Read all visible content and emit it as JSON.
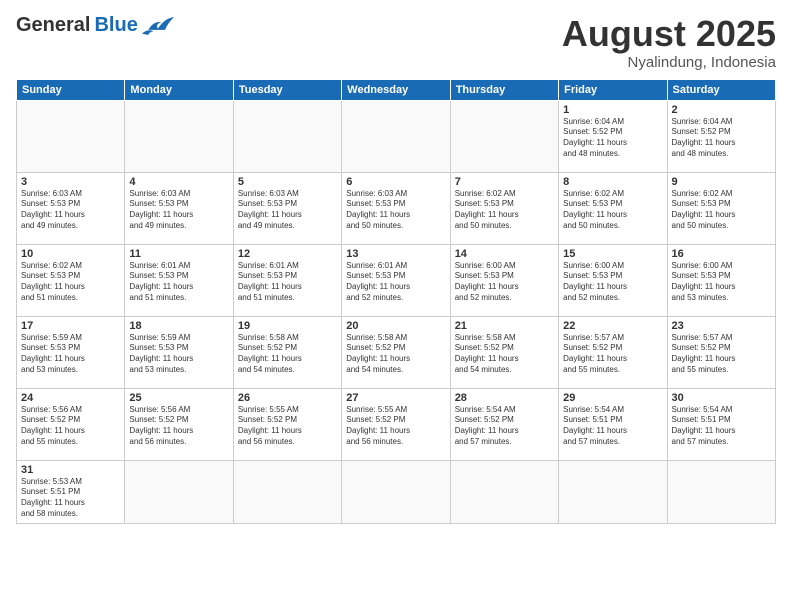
{
  "header": {
    "logo_general": "General",
    "logo_blue": "Blue",
    "month": "August 2025",
    "location": "Nyalindung, Indonesia"
  },
  "days": [
    "Sunday",
    "Monday",
    "Tuesday",
    "Wednesday",
    "Thursday",
    "Friday",
    "Saturday"
  ],
  "weeks": [
    [
      {
        "num": "",
        "text": ""
      },
      {
        "num": "",
        "text": ""
      },
      {
        "num": "",
        "text": ""
      },
      {
        "num": "",
        "text": ""
      },
      {
        "num": "",
        "text": ""
      },
      {
        "num": "1",
        "text": "Sunrise: 6:04 AM\nSunset: 5:52 PM\nDaylight: 11 hours\nand 48 minutes."
      },
      {
        "num": "2",
        "text": "Sunrise: 6:04 AM\nSunset: 5:52 PM\nDaylight: 11 hours\nand 48 minutes."
      }
    ],
    [
      {
        "num": "3",
        "text": "Sunrise: 6:03 AM\nSunset: 5:53 PM\nDaylight: 11 hours\nand 49 minutes."
      },
      {
        "num": "4",
        "text": "Sunrise: 6:03 AM\nSunset: 5:53 PM\nDaylight: 11 hours\nand 49 minutes."
      },
      {
        "num": "5",
        "text": "Sunrise: 6:03 AM\nSunset: 5:53 PM\nDaylight: 11 hours\nand 49 minutes."
      },
      {
        "num": "6",
        "text": "Sunrise: 6:03 AM\nSunset: 5:53 PM\nDaylight: 11 hours\nand 50 minutes."
      },
      {
        "num": "7",
        "text": "Sunrise: 6:02 AM\nSunset: 5:53 PM\nDaylight: 11 hours\nand 50 minutes."
      },
      {
        "num": "8",
        "text": "Sunrise: 6:02 AM\nSunset: 5:53 PM\nDaylight: 11 hours\nand 50 minutes."
      },
      {
        "num": "9",
        "text": "Sunrise: 6:02 AM\nSunset: 5:53 PM\nDaylight: 11 hours\nand 50 minutes."
      }
    ],
    [
      {
        "num": "10",
        "text": "Sunrise: 6:02 AM\nSunset: 5:53 PM\nDaylight: 11 hours\nand 51 minutes."
      },
      {
        "num": "11",
        "text": "Sunrise: 6:01 AM\nSunset: 5:53 PM\nDaylight: 11 hours\nand 51 minutes."
      },
      {
        "num": "12",
        "text": "Sunrise: 6:01 AM\nSunset: 5:53 PM\nDaylight: 11 hours\nand 51 minutes."
      },
      {
        "num": "13",
        "text": "Sunrise: 6:01 AM\nSunset: 5:53 PM\nDaylight: 11 hours\nand 52 minutes."
      },
      {
        "num": "14",
        "text": "Sunrise: 6:00 AM\nSunset: 5:53 PM\nDaylight: 11 hours\nand 52 minutes."
      },
      {
        "num": "15",
        "text": "Sunrise: 6:00 AM\nSunset: 5:53 PM\nDaylight: 11 hours\nand 52 minutes."
      },
      {
        "num": "16",
        "text": "Sunrise: 6:00 AM\nSunset: 5:53 PM\nDaylight: 11 hours\nand 53 minutes."
      }
    ],
    [
      {
        "num": "17",
        "text": "Sunrise: 5:59 AM\nSunset: 5:53 PM\nDaylight: 11 hours\nand 53 minutes."
      },
      {
        "num": "18",
        "text": "Sunrise: 5:59 AM\nSunset: 5:53 PM\nDaylight: 11 hours\nand 53 minutes."
      },
      {
        "num": "19",
        "text": "Sunrise: 5:58 AM\nSunset: 5:52 PM\nDaylight: 11 hours\nand 54 minutes."
      },
      {
        "num": "20",
        "text": "Sunrise: 5:58 AM\nSunset: 5:52 PM\nDaylight: 11 hours\nand 54 minutes."
      },
      {
        "num": "21",
        "text": "Sunrise: 5:58 AM\nSunset: 5:52 PM\nDaylight: 11 hours\nand 54 minutes."
      },
      {
        "num": "22",
        "text": "Sunrise: 5:57 AM\nSunset: 5:52 PM\nDaylight: 11 hours\nand 55 minutes."
      },
      {
        "num": "23",
        "text": "Sunrise: 5:57 AM\nSunset: 5:52 PM\nDaylight: 11 hours\nand 55 minutes."
      }
    ],
    [
      {
        "num": "24",
        "text": "Sunrise: 5:56 AM\nSunset: 5:52 PM\nDaylight: 11 hours\nand 55 minutes."
      },
      {
        "num": "25",
        "text": "Sunrise: 5:56 AM\nSunset: 5:52 PM\nDaylight: 11 hours\nand 56 minutes."
      },
      {
        "num": "26",
        "text": "Sunrise: 5:55 AM\nSunset: 5:52 PM\nDaylight: 11 hours\nand 56 minutes."
      },
      {
        "num": "27",
        "text": "Sunrise: 5:55 AM\nSunset: 5:52 PM\nDaylight: 11 hours\nand 56 minutes."
      },
      {
        "num": "28",
        "text": "Sunrise: 5:54 AM\nSunset: 5:52 PM\nDaylight: 11 hours\nand 57 minutes."
      },
      {
        "num": "29",
        "text": "Sunrise: 5:54 AM\nSunset: 5:51 PM\nDaylight: 11 hours\nand 57 minutes."
      },
      {
        "num": "30",
        "text": "Sunrise: 5:54 AM\nSunset: 5:51 PM\nDaylight: 11 hours\nand 57 minutes."
      }
    ],
    [
      {
        "num": "31",
        "text": "Sunrise: 5:53 AM\nSunset: 5:51 PM\nDaylight: 11 hours\nand 58 minutes."
      },
      {
        "num": "",
        "text": ""
      },
      {
        "num": "",
        "text": ""
      },
      {
        "num": "",
        "text": ""
      },
      {
        "num": "",
        "text": ""
      },
      {
        "num": "",
        "text": ""
      },
      {
        "num": "",
        "text": ""
      }
    ]
  ]
}
